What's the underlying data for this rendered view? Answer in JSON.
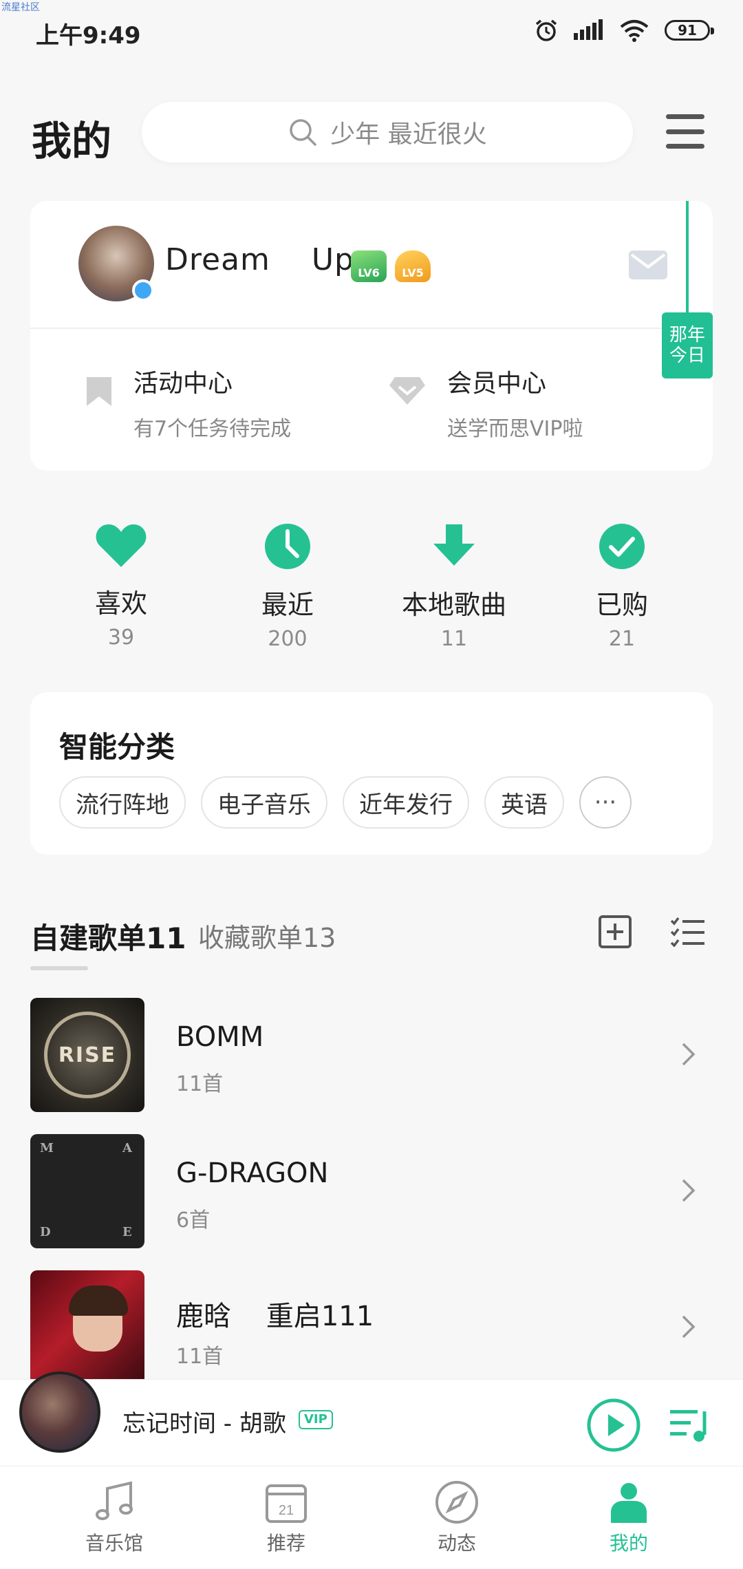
{
  "watermark": "流星社区",
  "status_bar": {
    "time": "上午9:49",
    "battery": "91",
    "icons": [
      "alarm-icon",
      "signal-icon",
      "wifi-icon",
      "battery-icon"
    ]
  },
  "header": {
    "title": "我的",
    "search_placeholder": "少年 最近很火"
  },
  "profile": {
    "username": "Dream    Up",
    "badges": [
      "LV6",
      "LV5"
    ],
    "activity": {
      "title": "活动中心",
      "subtitle": "有7个任务待完成"
    },
    "vip": {
      "title": "会员中心",
      "subtitle": "送学而思VIP啦"
    },
    "hanging_tag": "那年今日"
  },
  "stats": [
    {
      "label": "喜欢",
      "count": "39",
      "icon": "heart-icon"
    },
    {
      "label": "最近",
      "count": "200",
      "icon": "clock-icon"
    },
    {
      "label": "本地歌曲",
      "count": "11",
      "icon": "download-icon"
    },
    {
      "label": "已购",
      "count": "21",
      "icon": "check-icon"
    }
  ],
  "smart_category": {
    "title": "智能分类",
    "chips": [
      "流行阵地",
      "电子音乐",
      "近年发行",
      "英语"
    ],
    "more": "···"
  },
  "playlist_tabs": {
    "created": "自建歌单11",
    "collected": "收藏歌单13"
  },
  "playlists": [
    {
      "name": "BOMM",
      "count": "11首",
      "cover_text": "RISE"
    },
    {
      "name": "G-DRAGON",
      "count": "6首",
      "cover_letters": [
        "M",
        "A",
        "D",
        "E"
      ]
    },
    {
      "name": "鹿晗    重启111",
      "count": "11首"
    }
  ],
  "mini_player": {
    "title": "忘记时间 - 胡歌",
    "badge": "VIP"
  },
  "bottom_nav": [
    {
      "label": "音乐馆",
      "icon": "music-note-icon"
    },
    {
      "label": "推荐",
      "icon": "calendar-icon",
      "icon_text": "21"
    },
    {
      "label": "动态",
      "icon": "compass-icon"
    },
    {
      "label": "我的",
      "icon": "person-icon",
      "active": true
    }
  ],
  "colors": {
    "accent": "#25c193",
    "background": "#f7f7f7",
    "card": "#ffffff"
  }
}
